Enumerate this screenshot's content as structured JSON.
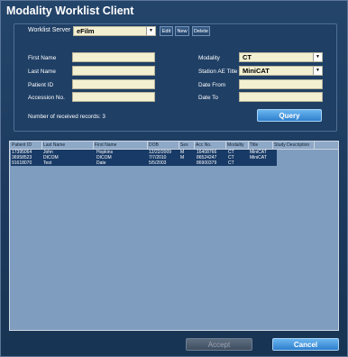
{
  "window": {
    "title": "Modality Worklist Client"
  },
  "server": {
    "label": "Worklist Server",
    "value": "eFilm",
    "edit_label": "Edit",
    "new_label": "New",
    "delete_label": "Delete"
  },
  "form": {
    "first_name_label": "First Name",
    "last_name_label": "Last Name",
    "patient_id_label": "Patient ID",
    "accession_label": "Accession No.",
    "modality_label": "Modality",
    "modality_value": "CT",
    "station_label": "Station AE Title",
    "station_value": "MiniCAT",
    "date_from_label": "Date From",
    "date_to_label": "Date To",
    "records_label": "Number of received records: 3",
    "query_label": "Query"
  },
  "table": {
    "columns": [
      "Patient ID",
      "Last Name",
      "First Name",
      "DOB",
      "Sex",
      "Acc No.",
      "Modality",
      "Title",
      "Study Description"
    ],
    "rows": [
      [
        "17395064",
        "John",
        "Hopkins",
        "12/22/2009",
        "M",
        "16408766",
        "CT",
        "MiniCAT",
        ""
      ],
      [
        "36958523",
        "DICOM",
        "DICOM",
        "7/7/2010",
        "M",
        "86524247",
        "CT",
        "MiniCAT",
        ""
      ],
      [
        "91618070",
        "Test",
        "Date",
        "5/5/2003",
        "",
        "86900379",
        "CT",
        "",
        ""
      ]
    ]
  },
  "footer": {
    "accept_label": "Accept",
    "cancel_label": "Cancel"
  }
}
